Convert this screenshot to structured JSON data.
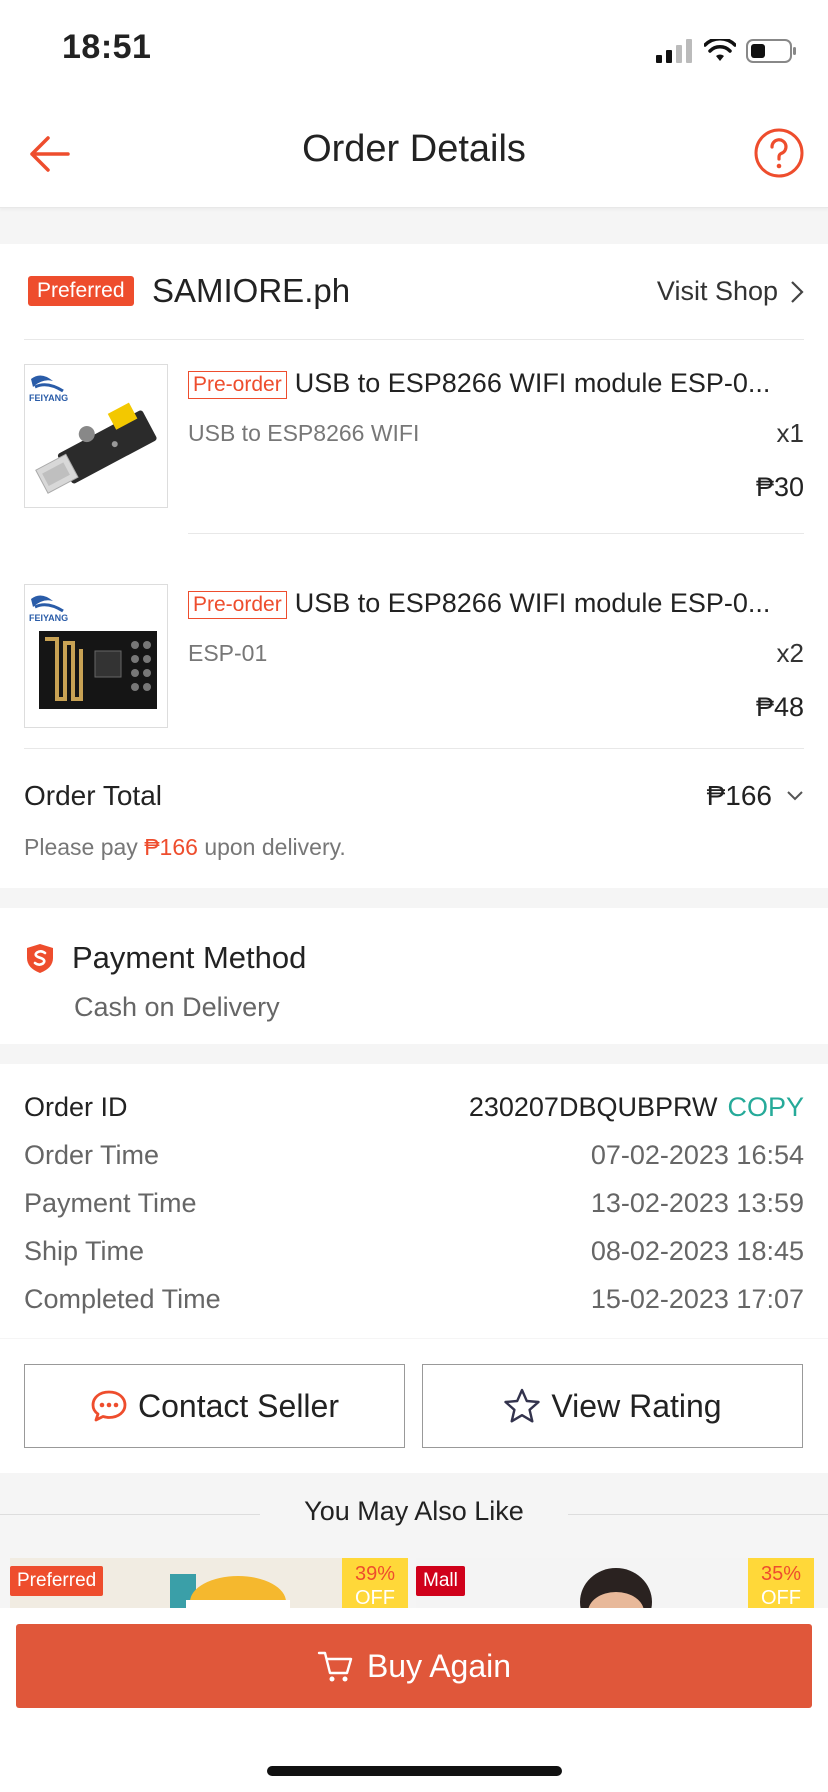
{
  "status_bar": {
    "time": "18:51"
  },
  "header": {
    "title": "Order Details"
  },
  "shop": {
    "badge": "Preferred",
    "name": "SAMIORE.ph",
    "visit_label": "Visit Shop"
  },
  "items": [
    {
      "tag": "Pre-order",
      "title": "USB to ESP8266 WIFI module ESP-0...",
      "variant": "USB to ESP8266 WIFI",
      "qty": "x1",
      "price": "₱30",
      "thumb_brand": "FEIYANG"
    },
    {
      "tag": "Pre-order",
      "title": "USB to ESP8266 WIFI module ESP-0...",
      "variant": "ESP-01",
      "qty": "x2",
      "price": "₱48",
      "thumb_brand": "FEIYANG"
    }
  ],
  "order_total": {
    "label": "Order Total",
    "value": "₱166",
    "note_prefix": "Please pay",
    "note_amount": "₱166",
    "note_suffix": "upon delivery."
  },
  "payment": {
    "title": "Payment Method",
    "value": "Cash on Delivery"
  },
  "order_info": {
    "id_label": "Order ID",
    "id_value": "230207DBQUBPRW",
    "copy_label": "COPY",
    "rows": [
      {
        "label": "Order Time",
        "value": "07-02-2023 16:54"
      },
      {
        "label": "Payment Time",
        "value": "13-02-2023 13:59"
      },
      {
        "label": "Ship Time",
        "value": "08-02-2023 18:45"
      },
      {
        "label": "Completed Time",
        "value": "15-02-2023 17:07"
      }
    ]
  },
  "actions": {
    "contact_seller": "Contact Seller",
    "view_rating": "View Rating"
  },
  "recommendations": {
    "title": "You May Also Like",
    "cards": [
      {
        "badge": "Preferred",
        "off_pct": "39%",
        "off_label": "OFF"
      },
      {
        "badge": "Mall",
        "off_pct": "35%",
        "off_label": "OFF"
      }
    ]
  },
  "footer": {
    "buy_again": "Buy Again"
  },
  "colors": {
    "brand": "#ee4d2d",
    "buy_button": "#e0573a",
    "copy": "#26aa99",
    "mall_badge": "#d0011b"
  },
  "icons": [
    "back-arrow-icon",
    "help-icon",
    "chevron-right-icon",
    "chevron-down-icon",
    "shield-icon",
    "chat-icon",
    "star-icon",
    "cart-icon",
    "signal-icon",
    "wifi-icon",
    "battery-icon"
  ]
}
